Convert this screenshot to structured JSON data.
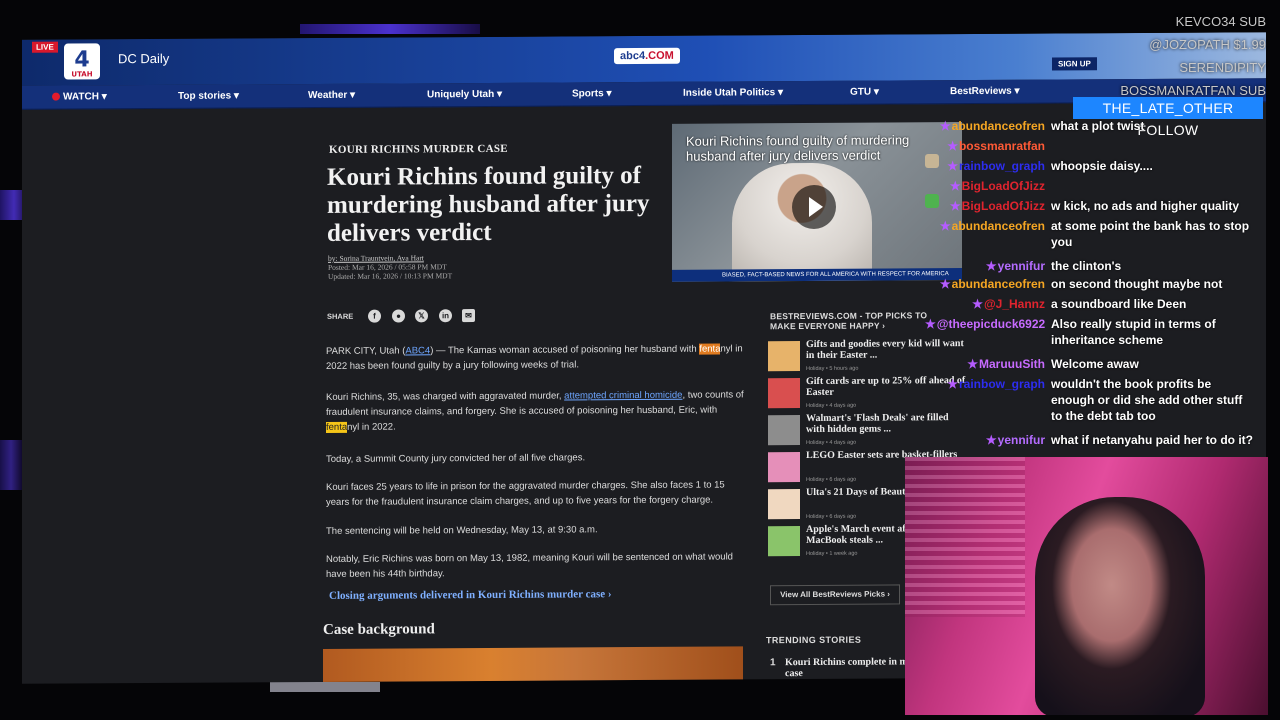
{
  "site": {
    "live_badge": "LIVE",
    "logo_text": "4",
    "logo_sub": "UTAH",
    "title": "DC Daily",
    "center_logo_prefix": "abc4",
    "center_logo_suffix": ".COM",
    "signup": "SIGN UP"
  },
  "nav": [
    "WATCH",
    "Top stories",
    "Weather",
    "Uniquely Utah",
    "Sports",
    "Inside Utah Politics",
    "GTU",
    "BestReviews"
  ],
  "article": {
    "kicker": "KOURI RICHINS MURDER CASE",
    "headline": "Kouri Richins found guilty of murdering husband after jury delivers verdict",
    "byline": "by: Sorina Trauntvein, Ava Hart",
    "posted": "Posted: Mar 16, 2026 / 05:58 PM MDT",
    "updated": "Updated: Mar 16, 2026 / 10:13 PM MDT",
    "share_label": "SHARE",
    "p1_a": "PARK CITY, Utah (",
    "p1_link": "ABC4",
    "p1_b": ") — The Kamas woman accused of poisoning her husband with ",
    "p1_hl": "fenta",
    "p1_c": "nyl in 2022 has been found guilty by a jury following weeks of trial.",
    "p2_a": "Kouri Richins, 35, was charged with aggravated murder, ",
    "p2_link": "attempted criminal homicide",
    "p2_b": ", two counts of fraudulent insurance claims, and forgery. She is accused of poisoning her husband, Eric, with ",
    "p2_hl": "fenta",
    "p2_c": "nyl in 2022.",
    "p3": "Today, a Summit County jury convicted her of all five charges.",
    "p4": "Kouri faces 25 years to life in prison for the aggravated murder charges. She also faces 1 to 15 years for the fraudulent insurance claim charges, and up to five years for the forgery charge.",
    "p5": "The sentencing will be held on Wednesday, May 13, at 9:30 a.m.",
    "p6": "Notably, Eric Richins was born on May 13, 1982, meaning Kouri will be sentenced on what would have been his 44th birthday.",
    "related": "Closing arguments delivered in Kouri Richins murder case",
    "section": "Case background"
  },
  "video": {
    "title": "Kouri Richins found guilty of murdering husband after jury delivers verdict",
    "ticker": "BIASED, FACT-BASED NEWS FOR ALL AMERICA WITH RESPECT FOR AMERICA"
  },
  "bestreviews": {
    "heading": "BESTREVIEWS.COM - TOP PICKS TO MAKE EVERYONE HAPPY",
    "items": [
      {
        "title": "Gifts and goodies every kid will want in their Easter ...",
        "meta": "Holiday • 5 hours ago",
        "color": "#e7b36a"
      },
      {
        "title": "Gift cards are up to 25% off ahead of Easter",
        "meta": "Holiday • 4 days ago",
        "color": "#d94f4f"
      },
      {
        "title": "Walmart's 'Flash Deals' are filled with hidden gems ...",
        "meta": "Holiday • 4 days ago",
        "color": "#8d8d8d"
      },
      {
        "title": "LEGO Easter sets are basket-fillers",
        "meta": "Holiday • 6 days ago",
        "color": "#e58fb9"
      },
      {
        "title": "Ulta's 21 Days of Beauty today",
        "meta": "Holiday • 6 days ago",
        "color": "#f0d8c0"
      },
      {
        "title": "Apple's March event affordable MacBook steals ...",
        "meta": "Holiday • 1 week ago",
        "color": "#8ac46a"
      }
    ],
    "view_all": "View All BestReviews Picks"
  },
  "trending": {
    "heading": "TRENDING STORIES",
    "num": "1",
    "title": "Kouri Richins complete in murder case"
  },
  "stream": {
    "alerts": [
      "KEVCO34 SUB",
      "@JOZOPATH $1.99",
      "SERENDIPITY",
      "BOSSMANRATFAN SUB"
    ],
    "follow": "THE_LATE_OTHER FOLLOW",
    "chat": [
      {
        "user": "abundanceofren",
        "msg": "what a plot twist",
        "color": "#f5a623"
      },
      {
        "user": "bossmanratfan",
        "msg": "",
        "color": "#ff5a36"
      },
      {
        "user": "rainbow_graph",
        "msg": "whoopsie daisy....",
        "color": "#2d2df0"
      },
      {
        "user": "BigLoadOfJizz",
        "msg": "",
        "color": "#e0242e"
      },
      {
        "user": "BigLoadOfJizz",
        "msg": "w kick, no ads and higher quality",
        "color": "#e0242e"
      },
      {
        "user": "abundanceofren",
        "msg": "at some point the bank has to stop you",
        "color": "#f5a623"
      },
      {
        "user": "yennifur",
        "msg": "the clinton's",
        "color": "#b46cff"
      },
      {
        "user": "abundanceofren",
        "msg": "on second thought maybe not",
        "color": "#f5a623"
      },
      {
        "user": "@J_Hannz",
        "msg": "a soundboard like Deen",
        "color": "#e0242e"
      },
      {
        "user": "@theepicduck6922",
        "msg": "Also really stupid in terms of inheritance scheme",
        "color": "#c76bff"
      },
      {
        "user": "MaruuuSith",
        "msg": "Welcome awaw",
        "color": "#c76bff"
      },
      {
        "user": "rainbow_graph",
        "msg": "wouldn't the book profits be enough or did she add other stuff to the debt tab too",
        "color": "#2d2df0"
      },
      {
        "user": "yennifur",
        "msg": "what if netanyahu paid her to do it?",
        "color": "#b46cff"
      }
    ]
  }
}
